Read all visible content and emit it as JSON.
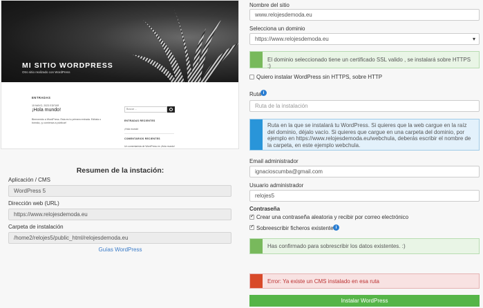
{
  "preview": {
    "site_title": "MI SITIO WORDPRESS",
    "site_subtitle": "Otro sitio realizado con WordPress",
    "section_label": "ENTRADAS",
    "post_date": "15 MAYO, 2023   EDITAR",
    "post_title": "¡Hola mundo!",
    "post_excerpt": "Bienvenido a WordPress. Esta es tu primera entrada. Edítala o bórrala, ¡y comienza a publicar!",
    "search_placeholder": "Buscar ...",
    "widget_recent_posts": "ENTRADAS RECIENTES",
    "widget_recent_posts_item": "¡Hola mundo!",
    "widget_recent_comments": "COMENTARIOS RECIENTES",
    "widget_recent_comments_item": "Un comentarista de WordPress en ¡Hola mundo!"
  },
  "summary": {
    "title": "Resumen de la instación:",
    "app_label": "Aplicación / CMS",
    "app_value": "WordPress 5",
    "url_label": "Dirección web (URL)",
    "url_value": "https://www.relojesdemoda.eu",
    "folder_label": "Carpeta de instalación",
    "folder_value": "/home2/relojes5/public_html/relojesdemoda.eu",
    "guides_link": "Guías WordPress"
  },
  "form": {
    "site_name_label": "Nombre del sitio",
    "site_name_value": "www.relojesdemoda.eu",
    "domain_label": "Selecciona un dominio",
    "domain_value": "https://www.relojesdemoda.eu",
    "ssl_alert": "El dominio seleccionado tiene un certificado SSL valido , se instalará sobre HTTPS :)",
    "https_checkbox_label": "Quiero instalar WordPress sin HTTPS, sobre HTTP",
    "path_label": "Ruta",
    "path_placeholder": "Ruta de la instalación",
    "path_info": "Ruta en la que se instalará tu WordPress. Si quieres que la web cargue en la raíz del dominio, déjalo vacío. Si quieres que cargue en una carpeta del dominio, por ejemplo en https://www.relojesdemoda.eu/webchula, deberás escribir el nombre de la carpeta, en este ejemplo webchula.",
    "email_label": "Email administrador",
    "email_value": "ignacioscumba@gmail.com",
    "user_label": "Usuario administrador",
    "user_value": "relojes5",
    "password_label": "Contraseña",
    "random_password_label": "Crear una contraseña aleatoria y recibir por correo electrónico",
    "overwrite_label": "Sobreescribir ficheros existentes",
    "overwrite_alert": "Has confirmado para sobrescribir los datos existentes. :)",
    "error_alert": "Error: Ya existe un CMS instalado en esa ruta",
    "install_button": "Instalar WordPress",
    "info_glyph": "i"
  }
}
